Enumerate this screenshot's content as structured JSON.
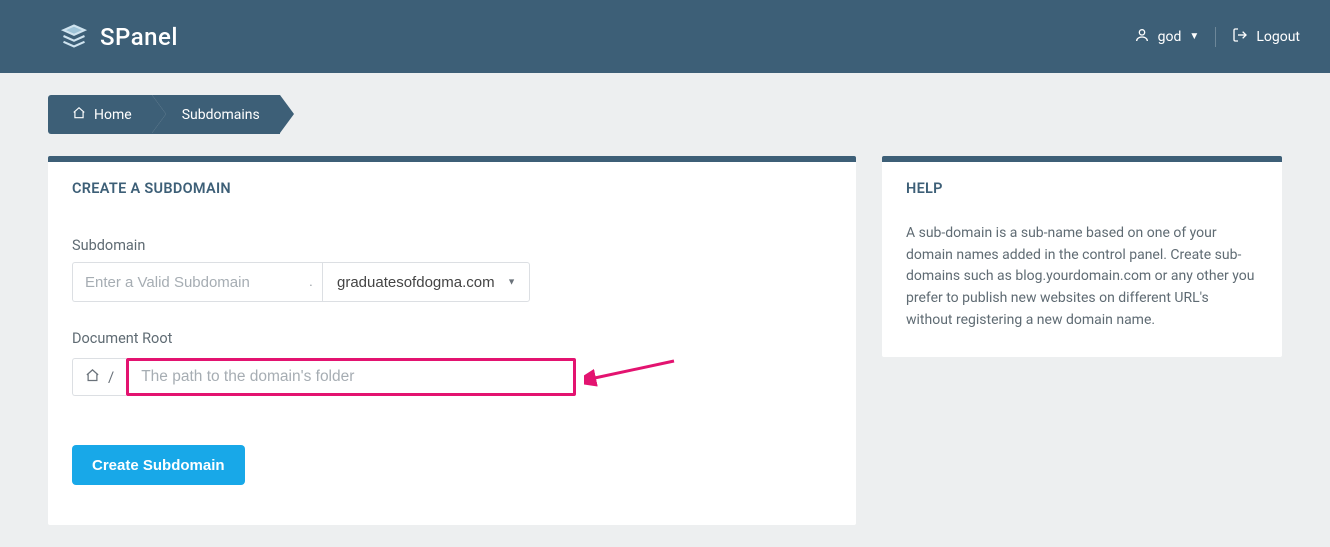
{
  "header": {
    "brand": "SPanel",
    "username": "god",
    "logout_label": "Logout"
  },
  "breadcrumbs": {
    "home": "Home",
    "current": "Subdomains"
  },
  "main": {
    "title": "CREATE A SUBDOMAIN",
    "subdomain_label": "Subdomain",
    "subdomain_placeholder": "Enter a Valid Subdomain",
    "dot": ".",
    "domain_selected": "graduatesofdogma.com",
    "docroot_label": "Document Root",
    "docroot_prefix": "/",
    "docroot_placeholder": "The path to the domain's folder",
    "create_button": "Create Subdomain"
  },
  "help": {
    "title": "HELP",
    "body": "A sub-domain is a sub-name based on one of your domain names added in the control panel. Create sub-domains such as blog.yourdomain.com or any other you prefer to publish new websites on different URL's without registering a new domain name."
  }
}
